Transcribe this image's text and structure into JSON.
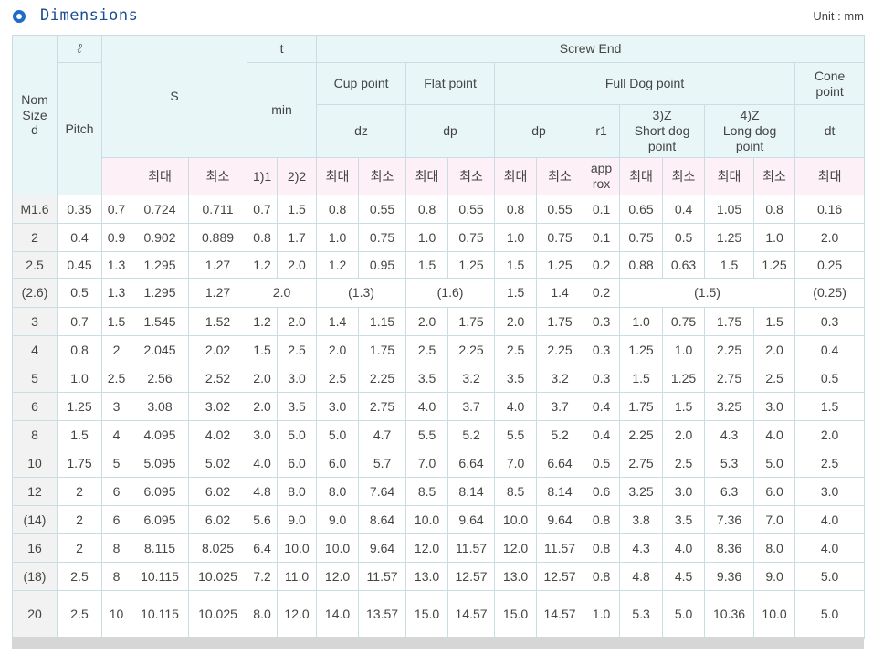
{
  "header": {
    "title": "Dimensions",
    "unit": "Unit : mm"
  },
  "table": {
    "col_nom": "Nom\nSize\nd",
    "col_l": "ℓ",
    "col_pitch": "Pitch",
    "col_s": "S",
    "col_t": "t",
    "col_min": "min",
    "screw_end": "Screw End",
    "cup_point": "Cup point",
    "flat_point": "Flat point",
    "full_dog_point": "Full Dog point",
    "cone_point": "Cone\npoint",
    "dz": "dz",
    "dp1": "dp",
    "dp2": "dp",
    "r1": "r1",
    "short_dog": "3)Z\nShort dog\npoint",
    "long_dog": "4)Z\nLong dog\npoint",
    "dt": "dt",
    "sub": [
      "",
      "최대",
      "최소",
      "1)1",
      "2)2",
      "최대",
      "최소",
      "최대",
      "최소",
      "최대",
      "최소",
      "app\nrox",
      "최대",
      "최소",
      "최대",
      "최소",
      "최대"
    ],
    "rows": [
      [
        "M1.6",
        "0.35",
        "0.7",
        "0.724",
        "0.711",
        "0.7",
        "1.5",
        "0.8",
        "0.55",
        "0.8",
        "0.55",
        "0.8",
        "0.55",
        "0.1",
        "0.65",
        "0.4",
        "1.05",
        "0.8",
        "0.16"
      ],
      [
        "2",
        "0.4",
        "0.9",
        "0.902",
        "0.889",
        "0.8",
        "1.7",
        "1.0",
        "0.75",
        "1.0",
        "0.75",
        "1.0",
        "0.75",
        "0.1",
        "0.75",
        "0.5",
        "1.25",
        "1.0",
        "2.0"
      ],
      [
        "2.5",
        "0.45",
        "1.3",
        "1.295",
        "1.27",
        "1.2",
        "2.0",
        "1.2",
        "0.95",
        "1.5",
        "1.25",
        "1.5",
        "1.25",
        "0.2",
        "0.88",
        "0.63",
        "1.5",
        "1.25",
        "0.25"
      ],
      [
        "(2.6)",
        "0.5",
        "1.3",
        "1.295",
        "1.27",
        "2.0",
        "(1.3)",
        "(1.6)",
        "1.5",
        "1.4",
        "0.2",
        "(1.5)",
        "(0.25)"
      ],
      [
        "3",
        "0.7",
        "1.5",
        "1.545",
        "1.52",
        "1.2",
        "2.0",
        "1.4",
        "1.15",
        "2.0",
        "1.75",
        "2.0",
        "1.75",
        "0.3",
        "1.0",
        "0.75",
        "1.75",
        "1.5",
        "0.3"
      ],
      [
        "4",
        "0.8",
        "2",
        "2.045",
        "2.02",
        "1.5",
        "2.5",
        "2.0",
        "1.75",
        "2.5",
        "2.25",
        "2.5",
        "2.25",
        "0.3",
        "1.25",
        "1.0",
        "2.25",
        "2.0",
        "0.4"
      ],
      [
        "5",
        "1.0",
        "2.5",
        "2.56",
        "2.52",
        "2.0",
        "3.0",
        "2.5",
        "2.25",
        "3.5",
        "3.2",
        "3.5",
        "3.2",
        "0.3",
        "1.5",
        "1.25",
        "2.75",
        "2.5",
        "0.5"
      ],
      [
        "6",
        "1.25",
        "3",
        "3.08",
        "3.02",
        "2.0",
        "3.5",
        "3.0",
        "2.75",
        "4.0",
        "3.7",
        "4.0",
        "3.7",
        "0.4",
        "1.75",
        "1.5",
        "3.25",
        "3.0",
        "1.5"
      ],
      [
        "8",
        "1.5",
        "4",
        "4.095",
        "4.02",
        "3.0",
        "5.0",
        "5.0",
        "4.7",
        "5.5",
        "5.2",
        "5.5",
        "5.2",
        "0.4",
        "2.25",
        "2.0",
        "4.3",
        "4.0",
        "2.0"
      ],
      [
        "10",
        "1.75",
        "5",
        "5.095",
        "5.02",
        "4.0",
        "6.0",
        "6.0",
        "5.7",
        "7.0",
        "6.64",
        "7.0",
        "6.64",
        "0.5",
        "2.75",
        "2.5",
        "5.3",
        "5.0",
        "2.5"
      ],
      [
        "12",
        "2",
        "6",
        "6.095",
        "6.02",
        "4.8",
        "8.0",
        "8.0",
        "7.64",
        "8.5",
        "8.14",
        "8.5",
        "8.14",
        "0.6",
        "3.25",
        "3.0",
        "6.3",
        "6.0",
        "3.0"
      ],
      [
        "(14)",
        "2",
        "6",
        "6.095",
        "6.02",
        "5.6",
        "9.0",
        "9.0",
        "8.64",
        "10.0",
        "9.64",
        "10.0",
        "9.64",
        "0.8",
        "3.8",
        "3.5",
        "7.36",
        "7.0",
        "4.0"
      ],
      [
        "16",
        "2",
        "8",
        "8.115",
        "8.025",
        "6.4",
        "10.0",
        "10.0",
        "9.64",
        "12.0",
        "11.57",
        "12.0",
        "11.57",
        "0.8",
        "4.3",
        "4.0",
        "8.36",
        "8.0",
        "4.0"
      ],
      [
        "(18)",
        "2.5",
        "8",
        "10.115",
        "10.025",
        "7.2",
        "11.0",
        "12.0",
        "11.57",
        "13.0",
        "12.57",
        "13.0",
        "12.57",
        "0.8",
        "4.8",
        "4.5",
        "9.36",
        "9.0",
        "5.0"
      ],
      [
        "20",
        "2.5",
        "10",
        "10.115",
        "10.025",
        "8.0",
        "12.0",
        "14.0",
        "13.57",
        "15.0",
        "14.57",
        "15.0",
        "14.57",
        "1.0",
        "5.3",
        "5.0",
        "10.36",
        "10.0",
        "5.0"
      ]
    ]
  },
  "colors": {
    "header_bg": "#e8f6f8",
    "pink_bg": "#fdf0f7",
    "border": "#c9dde2",
    "title": "#1a4d8f",
    "icon": "#1f6bc6"
  }
}
